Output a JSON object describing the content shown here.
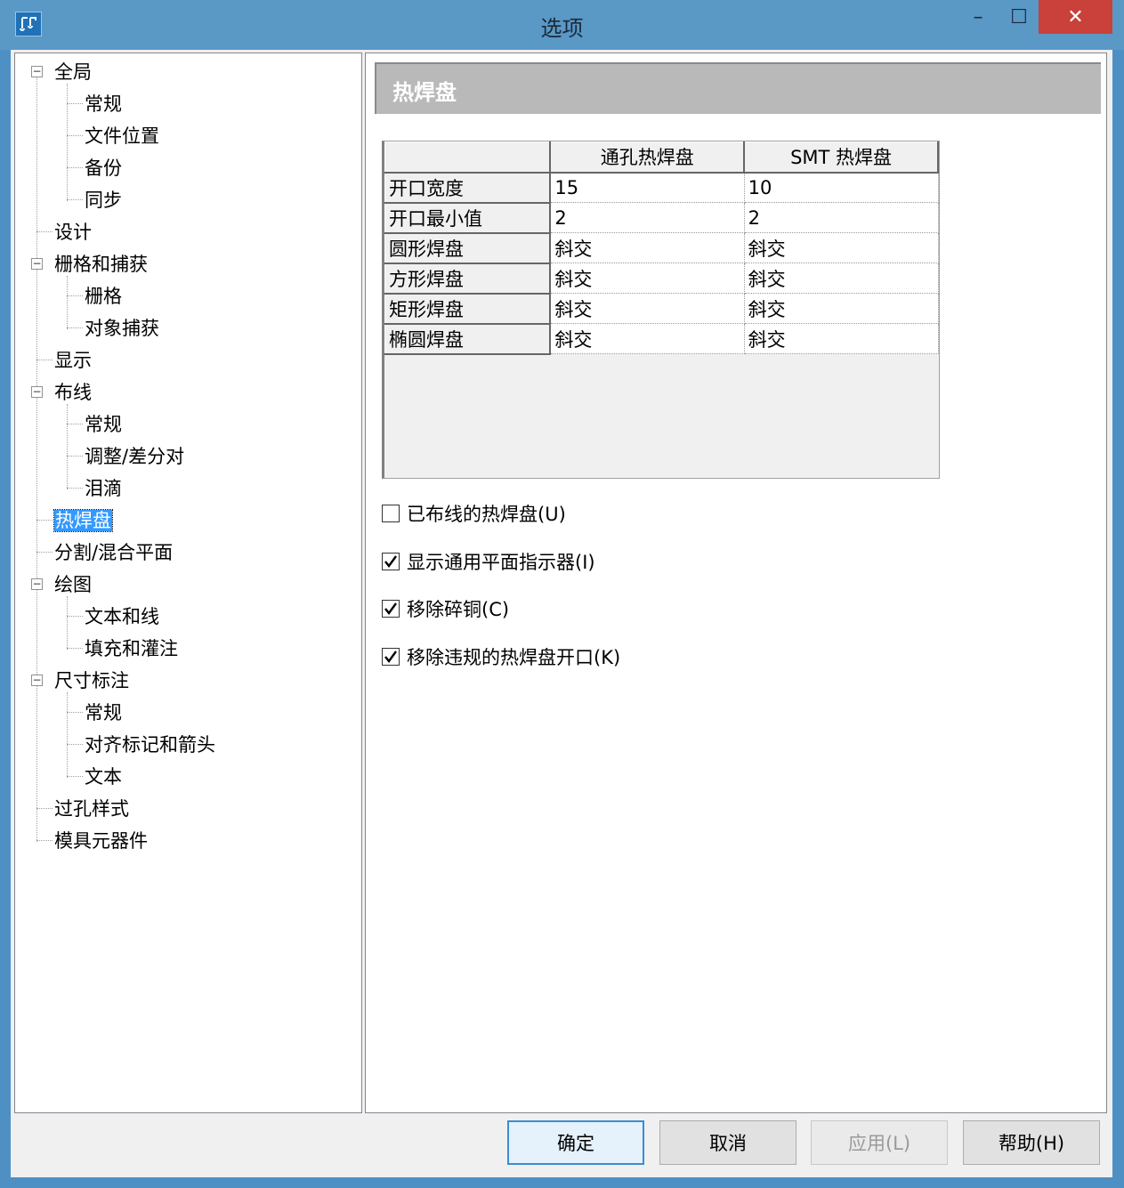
{
  "window": {
    "title": "选项"
  },
  "title_buttons": {
    "minimize": "–",
    "maximize": "☐",
    "close": "✕"
  },
  "tree": {
    "global": "全局",
    "global_general": "常规",
    "global_file_location": "文件位置",
    "global_backup": "备份",
    "global_sync": "同步",
    "design": "设计",
    "grid_snap": "栅格和捕获",
    "grid_snap_grid": "栅格",
    "grid_snap_object": "对象捕获",
    "display": "显示",
    "routing": "布线",
    "routing_general": "常规",
    "routing_adjust": "调整/差分对",
    "routing_teardrop": "泪滴",
    "thermal": "热焊盘",
    "split_plane": "分割/混合平面",
    "drawing": "绘图",
    "drawing_text_line": "文本和线",
    "drawing_fill": "填充和灌注",
    "dimension": "尺寸标注",
    "dimension_general": "常规",
    "dimension_align": "对齐标记和箭头",
    "dimension_text": "文本",
    "via_style": "过孔样式",
    "die_component": "模具元器件"
  },
  "panel": {
    "header": "热焊盘",
    "columns": [
      "通孔热焊盘",
      "SMT 热焊盘"
    ],
    "rows": [
      {
        "label": "开口宽度",
        "through_hole": "15",
        "smt": "10"
      },
      {
        "label": "开口最小值",
        "through_hole": "2",
        "smt": "2"
      },
      {
        "label": "圆形焊盘",
        "through_hole": "斜交",
        "smt": "斜交"
      },
      {
        "label": "方形焊盘",
        "through_hole": "斜交",
        "smt": "斜交"
      },
      {
        "label": "矩形焊盘",
        "through_hole": "斜交",
        "smt": "斜交"
      },
      {
        "label": "椭圆焊盘",
        "through_hole": "斜交",
        "smt": "斜交"
      }
    ],
    "checkboxes": [
      {
        "label": "已布线的热焊盘(U)",
        "checked": false
      },
      {
        "label": "显示通用平面指示器(I)",
        "checked": true
      },
      {
        "label": "移除碎铜(C)",
        "checked": true
      },
      {
        "label": "移除违规的热焊盘开口(K)",
        "checked": true
      }
    ]
  },
  "buttons": {
    "ok": "确定",
    "cancel": "取消",
    "apply": "应用(L)",
    "help": "帮助(H)"
  },
  "colors": {
    "titlebar": "#5a98c6",
    "close": "#c9413a",
    "selection": "#3399ff",
    "header": "#b9b9b9"
  }
}
